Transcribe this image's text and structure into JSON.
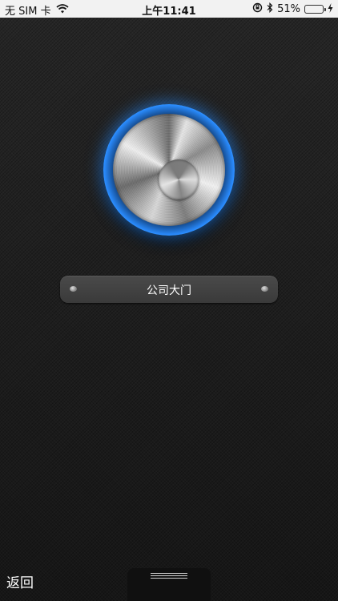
{
  "status_bar": {
    "carrier": "无 SIM 卡",
    "time": "上午11:41",
    "battery_percent": "51%",
    "battery_level": 0.51,
    "icons": [
      "wifi-icon",
      "orientation-lock-icon",
      "bluetooth-icon",
      "battery-icon",
      "charging-icon"
    ]
  },
  "door": {
    "name": "公司大门"
  },
  "bottom": {
    "back_label": "返回",
    "handle_icon": "menu-lines-icon"
  },
  "colors": {
    "accent_glow": "#2a8cff",
    "background": "#1a1a1a",
    "battery_green": "#4cd964"
  }
}
